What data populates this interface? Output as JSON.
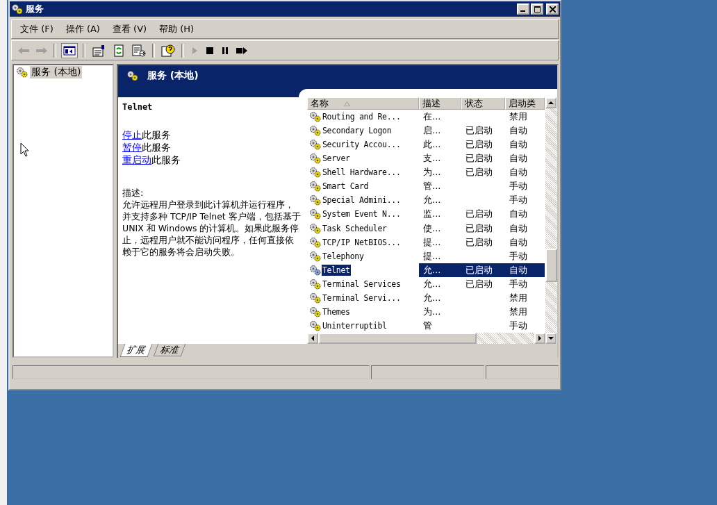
{
  "window": {
    "title": "服务"
  },
  "menu": [
    {
      "label": "文件 (F)"
    },
    {
      "label": "操作 (A)"
    },
    {
      "label": "查看 (V)"
    },
    {
      "label": "帮助 (H)"
    }
  ],
  "tree": {
    "items": [
      {
        "label": "服务 (本地)",
        "selected": true
      }
    ]
  },
  "panel": {
    "title": "服务 (本地)"
  },
  "details": {
    "service_name": "Telnet",
    "actions": [
      {
        "link": "停止",
        "text": "此服务"
      },
      {
        "link": "暂停",
        "text": "此服务"
      },
      {
        "link": "重启动",
        "text": "此服务"
      }
    ],
    "description_label": "描述:",
    "description": "允许远程用户登录到此计算机并运行程序，并支持多种 TCP/IP Telnet 客户端，包括基于 UNIX 和 Windows 的计算机。如果此服务停止，远程用户就不能访问程序，任何直接依赖于它的服务将会启动失败。"
  },
  "table": {
    "columns": [
      {
        "label": "名称",
        "sorted": true
      },
      {
        "label": "描述",
        "sorted": false
      },
      {
        "label": "状态",
        "sorted": false
      },
      {
        "label": "启动类",
        "sorted": false
      }
    ],
    "rows": [
      {
        "name": "Routing and Re...",
        "description": "在...",
        "status": "",
        "startup": "禁用",
        "selected": false
      },
      {
        "name": "Secondary Logon",
        "description": "启...",
        "status": "已启动",
        "startup": "自动",
        "selected": false
      },
      {
        "name": "Security Accou...",
        "description": "此...",
        "status": "已启动",
        "startup": "自动",
        "selected": false
      },
      {
        "name": "Server",
        "description": "支...",
        "status": "已启动",
        "startup": "自动",
        "selected": false
      },
      {
        "name": "Shell Hardware...",
        "description": "为...",
        "status": "已启动",
        "startup": "自动",
        "selected": false
      },
      {
        "name": "Smart Card",
        "description": "管...",
        "status": "",
        "startup": "手动",
        "selected": false
      },
      {
        "name": "Special Admini...",
        "description": "允...",
        "status": "",
        "startup": "手动",
        "selected": false
      },
      {
        "name": "System Event N...",
        "description": "监...",
        "status": "已启动",
        "startup": "自动",
        "selected": false
      },
      {
        "name": "Task Scheduler",
        "description": "使...",
        "status": "已启动",
        "startup": "自动",
        "selected": false
      },
      {
        "name": "TCP/IP NetBIOS...",
        "description": "提...",
        "status": "已启动",
        "startup": "自动",
        "selected": false
      },
      {
        "name": "Telephony",
        "description": "提...",
        "status": "",
        "startup": "手动",
        "selected": false
      },
      {
        "name": "Telnet",
        "description": "允...",
        "status": "已启动",
        "startup": "自动",
        "selected": true
      },
      {
        "name": "Terminal Services",
        "description": "允...",
        "status": "已启动",
        "startup": "手动",
        "selected": false
      },
      {
        "name": "Terminal Servi...",
        "description": "允...",
        "status": "",
        "startup": "禁用",
        "selected": false
      },
      {
        "name": "Themes",
        "description": "为...",
        "status": "",
        "startup": "禁用",
        "selected": false
      },
      {
        "name": "Uninterruptibl",
        "description": "管",
        "status": "",
        "startup": "手动",
        "selected": false
      }
    ]
  },
  "bottom_tabs": [
    {
      "label": "扩展",
      "selected": true
    },
    {
      "label": "标准",
      "selected": false
    }
  ]
}
